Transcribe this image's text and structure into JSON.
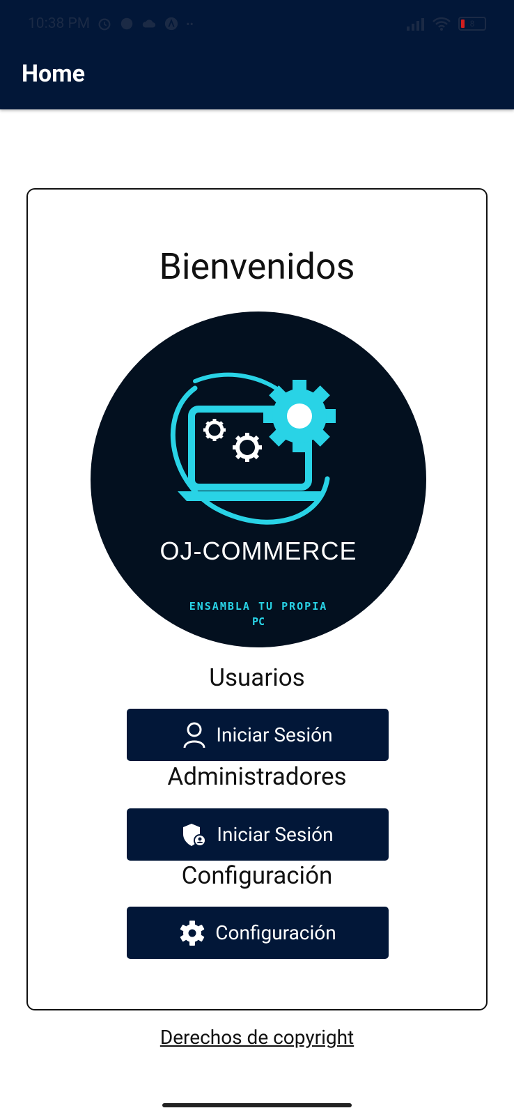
{
  "status_bar": {
    "time": "10:38 PM",
    "battery": "8",
    "icons": [
      "alarm-icon",
      "globe-icon",
      "cloud-icon",
      "app-icon",
      "more-icon",
      "signal-icon",
      "wifi-icon",
      "battery-icon"
    ]
  },
  "appbar": {
    "title": "Home"
  },
  "card": {
    "welcome": "Bienvenidos",
    "logo": {
      "brand": "OJ-COMMERCE",
      "tagline_line1": "ENSAMBLA TU PROPIA",
      "tagline_line2": "PC",
      "accent_color": "#29d3e6",
      "background_color": "#03101f"
    },
    "users": {
      "label": "Usuarios",
      "button": "Iniciar Sesión",
      "icon": "user-icon"
    },
    "admins": {
      "label": "Administradores",
      "button": "Iniciar Sesión",
      "icon": "admin-shield-icon"
    },
    "config": {
      "label": "Configuración",
      "button": "Configuración",
      "icon": "gear-icon"
    }
  },
  "footer": {
    "copyright": "Derechos de copyright"
  },
  "colors": {
    "primary": "#021738",
    "background": "#ffffff"
  }
}
